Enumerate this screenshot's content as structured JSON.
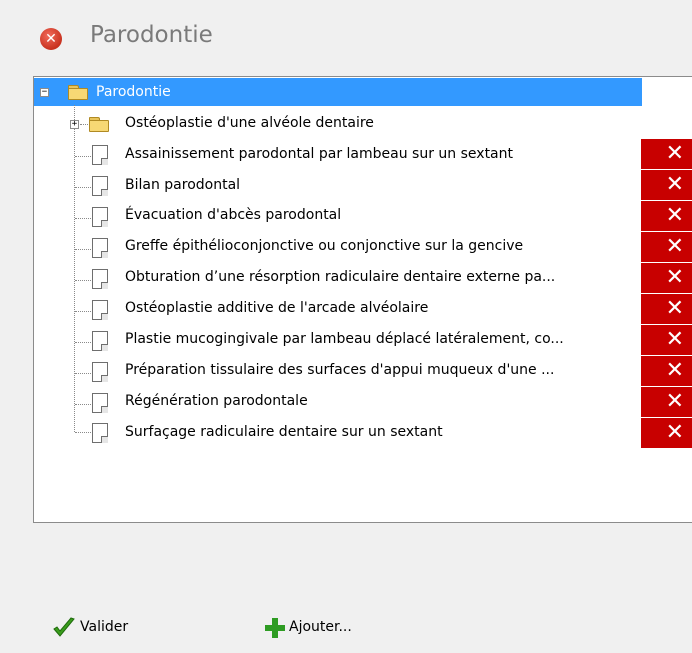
{
  "window": {
    "title": "Parodontie",
    "close_glyph": "✕"
  },
  "tree": {
    "root": {
      "label": "Parodontie",
      "expander": "−",
      "icon": "folder-open-icon"
    },
    "folder": {
      "label": "Ostéoplastie d'une alvéole dentaire",
      "expander": "+",
      "icon": "folder-icon"
    },
    "items": [
      {
        "label": "Assainissement parodontal par lambeau sur un sextant"
      },
      {
        "label": "Bilan parodontal"
      },
      {
        "label": "Évacuation d'abcès parodontal"
      },
      {
        "label": "Greffe épithélioconjonctive ou conjonctive sur la gencive"
      },
      {
        "label": "Obturation d’une résorption radiculaire dentaire externe pa..."
      },
      {
        "label": "Ostéoplastie additive de l'arcade alvéolaire"
      },
      {
        "label": "Plastie mucogingivale par lambeau déplacé latéralement, co..."
      },
      {
        "label": "Préparation tissulaire des surfaces d'appui muqueux d'une ..."
      },
      {
        "label": "Régénération parodontale"
      },
      {
        "label": "Surfaçage radiculaire dentaire sur un sextant"
      }
    ],
    "delete_glyph": "✕",
    "selection_color": "#3399ff",
    "delete_color": "#c80000"
  },
  "footer": {
    "validate_label": "Valider",
    "add_label": "Ajouter..."
  }
}
